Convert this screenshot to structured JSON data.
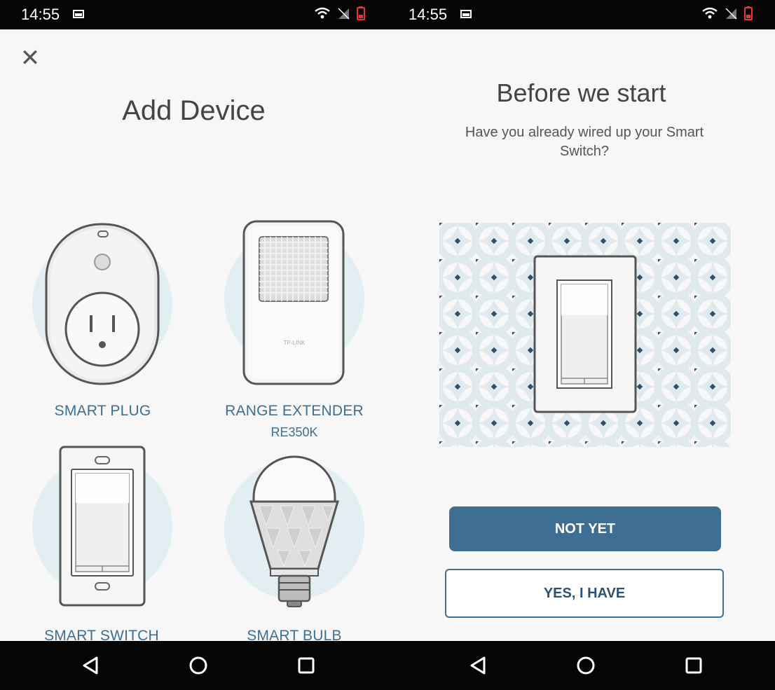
{
  "left_screen": {
    "status": {
      "time": "14:55"
    },
    "title": "Add Device",
    "devices": [
      {
        "label": "SMART PLUG",
        "icon": "smart-plug-icon"
      },
      {
        "label": "RANGE EXTENDER",
        "sublabel": "RE350K",
        "icon": "range-extender-icon",
        "brand": "TP-LINK"
      },
      {
        "label": "SMART SWITCH",
        "icon": "smart-switch-icon"
      },
      {
        "label": "SMART BULB",
        "icon": "smart-bulb-icon"
      }
    ]
  },
  "right_screen": {
    "status": {
      "time": "14:55"
    },
    "title": "Before we start",
    "subtitle": "Have you already wired up your Smart Switch?",
    "primary_button": "NOT YET",
    "secondary_button": "YES, I HAVE"
  },
  "colors": {
    "accent": "#3e6f92",
    "background": "#f7f7f7",
    "circle": "#e3eef3",
    "bars": "#050505"
  }
}
